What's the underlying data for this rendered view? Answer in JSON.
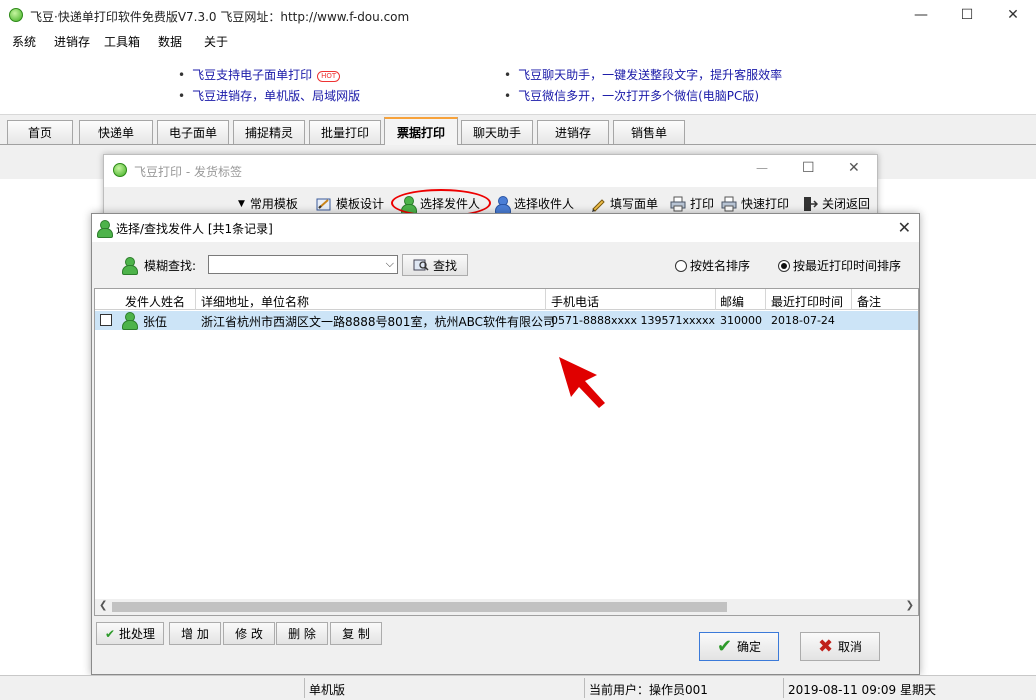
{
  "window": {
    "title": "飞豆·快递单打印软件免费版V7.3.0   飞豆网址：http://www.f-dou.com",
    "minimize": "—",
    "maximize": "☐",
    "close": "✕"
  },
  "menu": [
    "系统",
    "进销存",
    "工具箱",
    "数据",
    "关于"
  ],
  "promos": {
    "left": [
      "飞豆支持电子面单打印",
      "飞豆进销存，单机版、局域网版"
    ],
    "hot_badge": "HOT",
    "right": [
      "飞豆聊天助手，一键发送整段文字，提升客服效率",
      "飞豆微信多开，一次打开多个微信(电脑PC版)"
    ]
  },
  "tabs": [
    "首页",
    "快递单",
    "电子面单",
    "捕捉精灵",
    "批量打印",
    "票据打印",
    "聊天助手",
    "进销存",
    "销售单"
  ],
  "active_tab": "票据打印",
  "print_window": {
    "title": "飞豆打印 - 发货标签",
    "toolbar": [
      "常用模板",
      "模板设计",
      "选择发件人",
      "选择收件人",
      "填写面单",
      "打印",
      "快速打印",
      "关闭返回"
    ]
  },
  "dialog": {
    "title": "选择/查找发件人   [共1条记录]",
    "search_label": "模糊查找:",
    "search_value": "",
    "search_button": "查找",
    "sort_by_name": "按姓名排序",
    "sort_by_time": "按最近打印时间排序",
    "sort_selected": "time",
    "columns": [
      "发件人姓名",
      "详细地址，单位名称",
      "手机电话",
      "邮编",
      "最近打印时间",
      "备注"
    ],
    "rows": [
      {
        "name": "张伍",
        "address": "浙江省杭州市西湖区文一路8888号801室，杭州ABC软件有限公司",
        "phone": "0571-8888xxxx 139571xxxxx",
        "zip": "310000",
        "last_print": "2018-07-24",
        "note": ""
      }
    ],
    "buttons": {
      "batch": "批处理",
      "add": "增 加",
      "edit": "修 改",
      "delete": "删 除",
      "copy": "复 制",
      "ok": "确定",
      "cancel": "取消"
    }
  },
  "status": {
    "mode": "单机版",
    "user": "当前用户：操作员001",
    "datetime": "2019-08-11 09:09 星期天"
  },
  "colors": {
    "link_blue": "#1a1aa8",
    "active_tab_accent": "#f7a23a",
    "selection": "#cce4f7",
    "annotation_red": "#e00000"
  }
}
